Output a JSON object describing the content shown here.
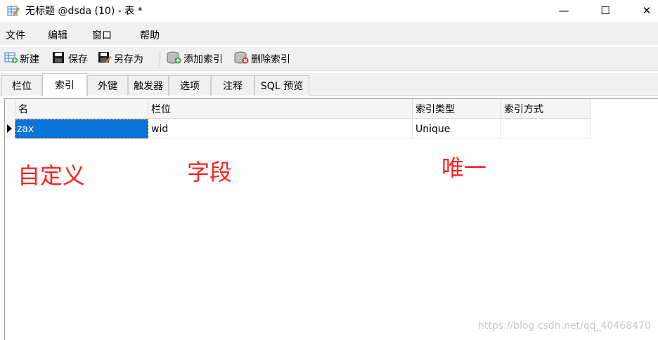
{
  "window": {
    "title": "无标题 @dsda (10) - 表 *",
    "minimize": "—",
    "maximize": "☐",
    "close": "✕"
  },
  "menu": {
    "items": [
      "文件",
      "编辑",
      "窗口",
      "帮助"
    ]
  },
  "toolbar": {
    "new_label": "新建",
    "save_label": "保存",
    "save_as_label": "另存为",
    "add_index_label": "添加索引",
    "delete_index_label": "删除索引"
  },
  "tabs": [
    "栏位",
    "索引",
    "外键",
    "触发器",
    "选项",
    "注释",
    "SQL 预览"
  ],
  "active_tab": "索引",
  "grid": {
    "columns": [
      "名",
      "栏位",
      "索引类型",
      "索引方式"
    ],
    "rows": [
      [
        "zax",
        "wid",
        "Unique",
        ""
      ]
    ]
  },
  "annotations": {
    "name": "自定义",
    "field": "字段",
    "unique": "唯一"
  },
  "watermark": "https://blog.csdn.net/qq_40468470",
  "colors": {
    "selection": "#0a74d8",
    "annotation": "#ff2020"
  }
}
